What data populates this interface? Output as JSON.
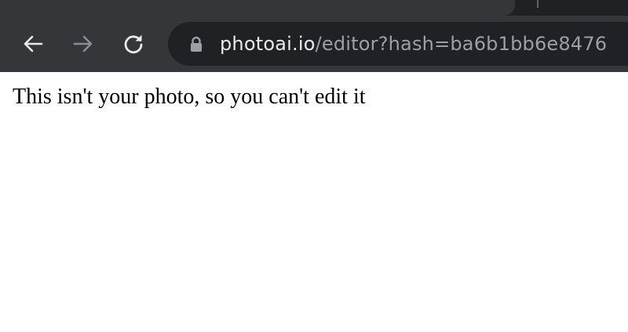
{
  "browser": {
    "url_host": "photoai.io",
    "url_path": "/editor?hash=ba6b1bb6e8476",
    "icons": {
      "back": "back-arrow-icon",
      "forward": "forward-arrow-icon",
      "reload": "reload-icon",
      "secure": "lock-icon"
    },
    "colors": {
      "chrome_bg": "#35363a",
      "omnibox_bg": "#202124",
      "url_host": "#e8eaed",
      "url_path": "#9aa0a6"
    }
  },
  "page": {
    "message": "This isn't your photo, so you can't edit it"
  }
}
